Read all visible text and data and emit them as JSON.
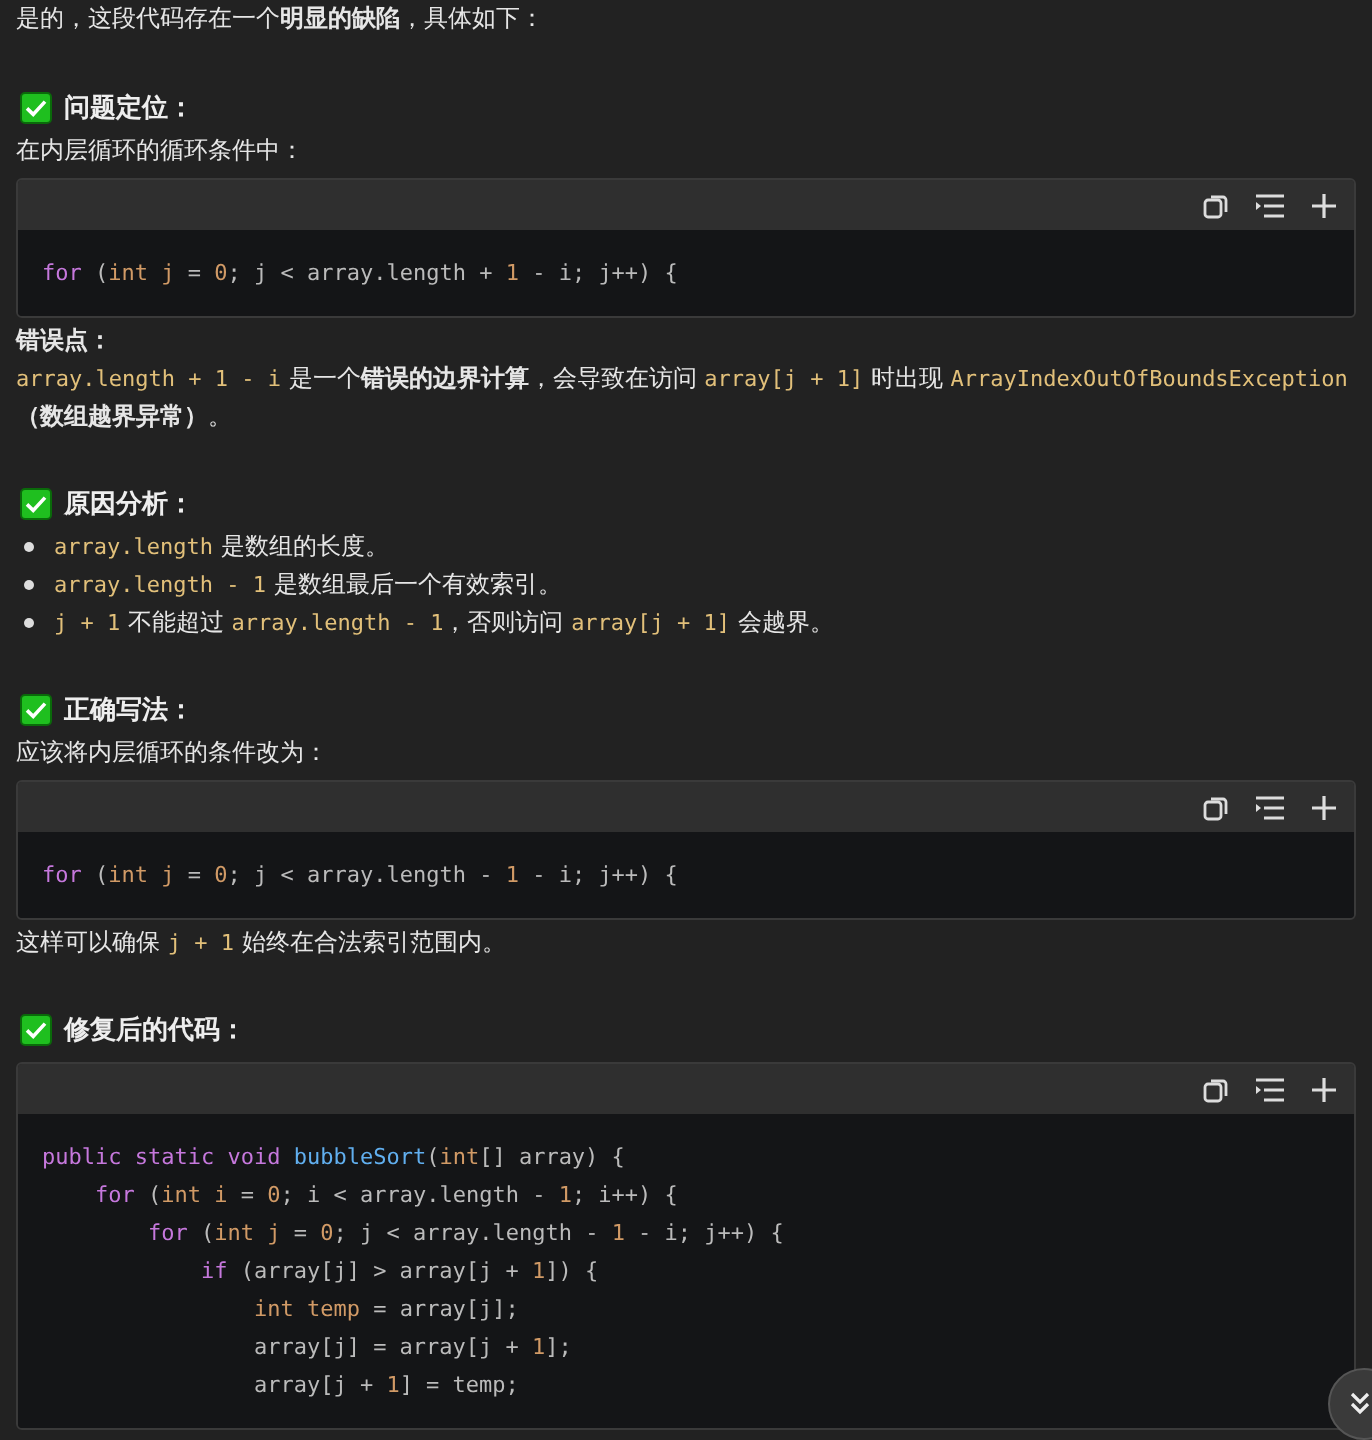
{
  "intro": [
    {
      "kind": "text",
      "text": "是的，这段代码存在一个"
    },
    {
      "kind": "bold",
      "text": "明显的缺陷"
    },
    {
      "kind": "text",
      "text": "，具体如下："
    }
  ],
  "sections": [
    {
      "heading": "问题定位：",
      "blocks": [
        {
          "kind": "para",
          "segments": [
            {
              "kind": "text",
              "text": "在内层循环的循环条件中："
            }
          ]
        },
        {
          "kind": "code",
          "lines": [
            [
              {
                "kind": "kw",
                "text": "for"
              },
              {
                "kind": "plain",
                "text": " ("
              },
              {
                "kind": "type",
                "text": "int j"
              },
              {
                "kind": "plain",
                "text": " = "
              },
              {
                "kind": "num",
                "text": "0"
              },
              {
                "kind": "plain",
                "text": "; j < array.length + "
              },
              {
                "kind": "num",
                "text": "1"
              },
              {
                "kind": "plain",
                "text": " - i; j++) {"
              }
            ]
          ]
        },
        {
          "kind": "para",
          "segments": [
            {
              "kind": "bold",
              "text": "错误点："
            }
          ]
        },
        {
          "kind": "para",
          "segments": [
            {
              "kind": "code",
              "text": "array.length + 1 - i"
            },
            {
              "kind": "text",
              "text": " 是一个"
            },
            {
              "kind": "bold",
              "text": "错误的边界计算"
            },
            {
              "kind": "text",
              "text": "，会导致在访问 "
            },
            {
              "kind": "code",
              "text": "array[j + 1]"
            },
            {
              "kind": "text",
              "text": " 时出现 "
            },
            {
              "kind": "code",
              "text": "ArrayIndexOutOfBoundsException"
            },
            {
              "kind": "bold",
              "text": "（数组越界异常）"
            },
            {
              "kind": "text",
              "text": "。"
            }
          ]
        }
      ]
    },
    {
      "heading": "原因分析：",
      "blocks": [
        {
          "kind": "list",
          "items": [
            [
              {
                "kind": "code",
                "text": "array.length"
              },
              {
                "kind": "text",
                "text": " 是数组的长度。"
              }
            ],
            [
              {
                "kind": "code",
                "text": "array.length - 1"
              },
              {
                "kind": "text",
                "text": " 是数组最后一个有效索引。"
              }
            ],
            [
              {
                "kind": "code",
                "text": "j + 1"
              },
              {
                "kind": "text",
                "text": " 不能超过 "
              },
              {
                "kind": "code",
                "text": "array.length - 1"
              },
              {
                "kind": "text",
                "text": "，否则访问 "
              },
              {
                "kind": "code",
                "text": "array[j + 1]"
              },
              {
                "kind": "text",
                "text": " 会越界。"
              }
            ]
          ]
        }
      ]
    },
    {
      "heading": "正确写法：",
      "blocks": [
        {
          "kind": "para",
          "segments": [
            {
              "kind": "text",
              "text": "应该将内层循环的条件改为："
            }
          ]
        },
        {
          "kind": "code",
          "lines": [
            [
              {
                "kind": "kw",
                "text": "for"
              },
              {
                "kind": "plain",
                "text": " ("
              },
              {
                "kind": "type",
                "text": "int j"
              },
              {
                "kind": "plain",
                "text": " = "
              },
              {
                "kind": "num",
                "text": "0"
              },
              {
                "kind": "plain",
                "text": "; j < array.length - "
              },
              {
                "kind": "num",
                "text": "1"
              },
              {
                "kind": "plain",
                "text": " - i; j++) {"
              }
            ]
          ]
        },
        {
          "kind": "para",
          "segments": [
            {
              "kind": "text",
              "text": "这样可以确保 "
            },
            {
              "kind": "code",
              "text": "j + 1"
            },
            {
              "kind": "text",
              "text": " 始终在合法索引范围内。"
            }
          ]
        }
      ]
    },
    {
      "heading": "修复后的代码：",
      "blocks": [
        {
          "kind": "code",
          "lines": [
            [
              {
                "kind": "kw",
                "text": "public static void"
              },
              {
                "kind": "fn",
                "text": " bubbleSort"
              },
              {
                "kind": "plain",
                "text": "("
              },
              {
                "kind": "type",
                "text": "int"
              },
              {
                "kind": "plain",
                "text": "[] array) {"
              }
            ],
            [
              {
                "kind": "kw",
                "text": "    for"
              },
              {
                "kind": "plain",
                "text": " ("
              },
              {
                "kind": "type",
                "text": "int i"
              },
              {
                "kind": "plain",
                "text": " = "
              },
              {
                "kind": "num",
                "text": "0"
              },
              {
                "kind": "plain",
                "text": "; i < array.length - "
              },
              {
                "kind": "num",
                "text": "1"
              },
              {
                "kind": "plain",
                "text": "; i++) {"
              }
            ],
            [
              {
                "kind": "kw",
                "text": "        for"
              },
              {
                "kind": "plain",
                "text": " ("
              },
              {
                "kind": "type",
                "text": "int j"
              },
              {
                "kind": "plain",
                "text": " = "
              },
              {
                "kind": "num",
                "text": "0"
              },
              {
                "kind": "plain",
                "text": "; j < array.length - "
              },
              {
                "kind": "num",
                "text": "1"
              },
              {
                "kind": "plain",
                "text": " - i; j++) {"
              }
            ],
            [
              {
                "kind": "kw",
                "text": "            if"
              },
              {
                "kind": "plain",
                "text": " (array[j] > array[j + "
              },
              {
                "kind": "num",
                "text": "1"
              },
              {
                "kind": "plain",
                "text": "]) {"
              }
            ],
            [
              {
                "kind": "type",
                "text": "                int temp"
              },
              {
                "kind": "plain",
                "text": " = array[j];"
              }
            ],
            [
              {
                "kind": "plain",
                "text": "                array[j] = array[j + "
              },
              {
                "kind": "num",
                "text": "1"
              },
              {
                "kind": "plain",
                "text": "];"
              }
            ],
            [
              {
                "kind": "plain",
                "text": "                array[j + "
              },
              {
                "kind": "num",
                "text": "1"
              },
              {
                "kind": "plain",
                "text": "] = temp;"
              }
            ]
          ]
        }
      ]
    }
  ]
}
